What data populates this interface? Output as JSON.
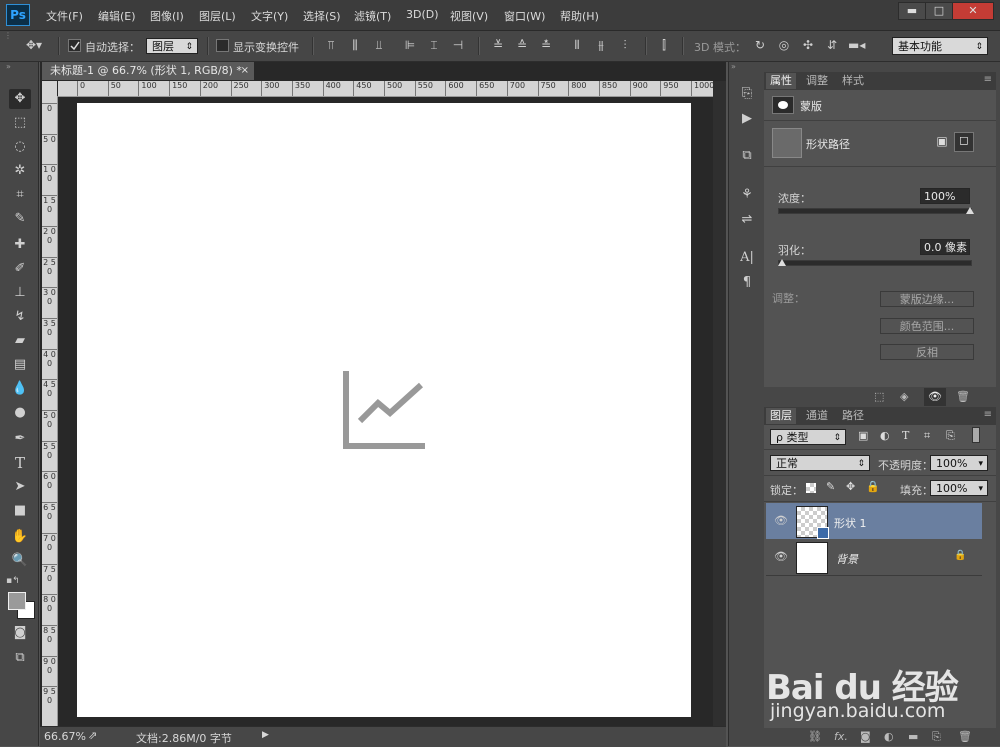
{
  "app": {
    "logo": "Ps"
  },
  "menu": [
    "文件(F)",
    "编辑(E)",
    "图像(I)",
    "图层(L)",
    "文字(Y)",
    "选择(S)",
    "滤镜(T)",
    "3D(D)",
    "视图(V)",
    "窗口(W)",
    "帮助(H)"
  ],
  "window_controls": {
    "minimize": "▬",
    "maximize": "□",
    "close": "✕"
  },
  "options": {
    "auto_select_label": "自动选择：",
    "auto_select_value": "图层",
    "show_transform_label": "显示变换控件",
    "mode_3d_label": "3D 模式：",
    "workspace": "基本功能"
  },
  "document": {
    "tab_title": "未标题-1 @ 66.7% (形状 1, RGB/8) *",
    "tab_close": "×",
    "ruler_h": [
      "0",
      "50",
      "100",
      "150",
      "200",
      "250",
      "300",
      "350",
      "400",
      "450",
      "500",
      "550",
      "600",
      "650",
      "700",
      "750",
      "800",
      "850",
      "900",
      "950",
      "1000"
    ],
    "ruler_v": [
      "0",
      "5 0",
      "1 0 0",
      "1 5 0",
      "2 0 0",
      "2 5 0",
      "3 0 0",
      "3 5 0",
      "4 0 0",
      "4 5 0",
      "5 0 0",
      "5 5 0",
      "6 0 0",
      "6 5 0",
      "7 0 0",
      "7 5 0",
      "8 0 0",
      "8 5 0",
      "9 0 0",
      "9 5 0"
    ]
  },
  "status": {
    "zoom": "66.67%",
    "doc_info": "文档:2.86M/0 字节"
  },
  "properties_panel": {
    "tabs": [
      "属性",
      "调整",
      "样式"
    ],
    "mask_title": "蒙版",
    "shape_path": "形状路径",
    "density_label": "浓度：",
    "density_value": "100%",
    "density": 1.0,
    "feather_label": "羽化：",
    "feather_value": "0.0 像素",
    "feather": 0.0,
    "adjust_label": "调整：",
    "buttons": [
      "蒙版边缘...",
      "颜色范围...",
      "反相"
    ]
  },
  "layers_panel": {
    "tabs": [
      "图层",
      "通道",
      "路径"
    ],
    "filter_kind": "ρ 类型",
    "blend_mode": "正常",
    "opacity_label": "不透明度：",
    "opacity_value": "100%",
    "lock_label": "锁定：",
    "fill_label": "填充：",
    "fill_value": "100%",
    "layers": [
      {
        "name": "形状 1",
        "selected": true
      },
      {
        "name": "背景",
        "selected": false
      }
    ]
  },
  "watermark": {
    "brand": "Bai du 经验",
    "url": "jingyan.baidu.com"
  },
  "colors": {
    "accent": "#2fa3ff",
    "selected_layer": "#6a7fa0",
    "canvas_icon": "#999999"
  }
}
